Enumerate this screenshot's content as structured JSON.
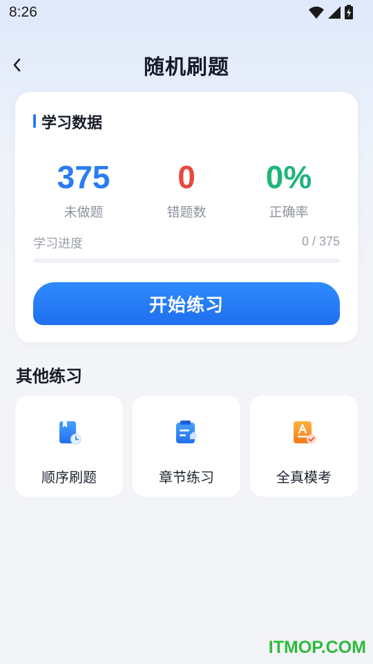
{
  "status_bar": {
    "time": "8:26",
    "icons": [
      "wifi-icon",
      "signal-icon",
      "battery-charging-icon"
    ]
  },
  "header": {
    "back_icon": "chevron-left-icon",
    "title": "随机刷题"
  },
  "study_card": {
    "title": "学习数据",
    "accent_color": "#2a7cf4",
    "stats": [
      {
        "value": "375",
        "label": "未做题",
        "color": "#2a7cf4"
      },
      {
        "value": "0",
        "label": "错题数",
        "color": "#e8483e"
      },
      {
        "value": "0%",
        "label": "正确率",
        "color": "#1fb57a"
      }
    ],
    "progress": {
      "label": "学习进度",
      "count_text": "0 / 375",
      "fraction": 0
    },
    "start_button_label": "开始练习"
  },
  "other_practice": {
    "title": "其他练习",
    "items": [
      {
        "label": "顺序刷题",
        "icon": "book-clock-icon"
      },
      {
        "label": "章节练习",
        "icon": "notepad-edit-icon"
      },
      {
        "label": "全真模考",
        "icon": "exam-paper-icon"
      }
    ]
  },
  "watermark": "ITMOP.COM"
}
